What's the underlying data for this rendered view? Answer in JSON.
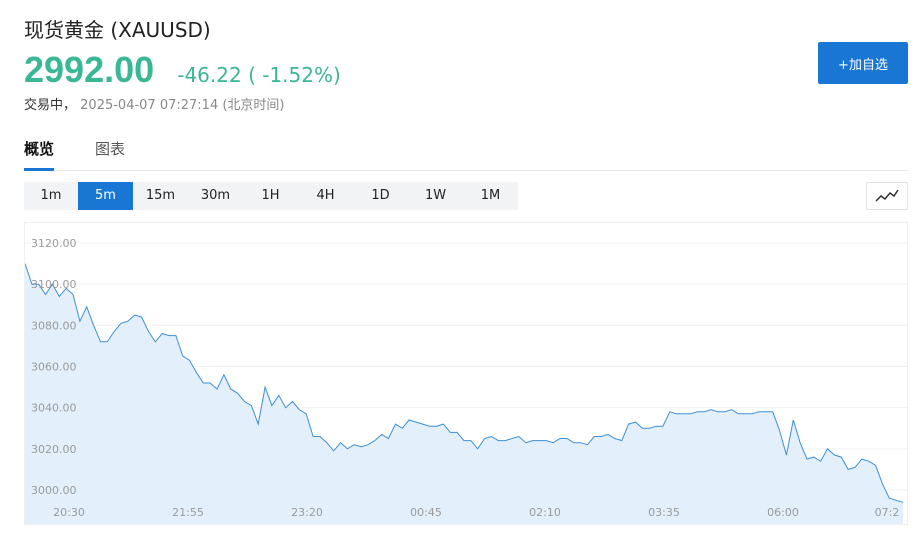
{
  "header": {
    "title": "现货黄金  (XAUUSD)",
    "price": "2992.00",
    "change": "-46.22 ( -1.52%)",
    "status": "交易中，",
    "timestamp": "2025-04-07 07:27:14 (北京时间)",
    "watch_button": "+加自选"
  },
  "tabs": [
    {
      "label": "概览",
      "active": true
    },
    {
      "label": "图表",
      "active": false
    }
  ],
  "intervals": [
    {
      "label": "1m",
      "active": false
    },
    {
      "label": "5m",
      "active": true
    },
    {
      "label": "15m",
      "active": false
    },
    {
      "label": "30m",
      "active": false
    },
    {
      "label": "1H",
      "active": false
    },
    {
      "label": "4H",
      "active": false
    },
    {
      "label": "1D",
      "active": false
    },
    {
      "label": "1W",
      "active": false
    },
    {
      "label": "1M",
      "active": false
    }
  ],
  "chart_type_icon": "line-chart-icon",
  "colors": {
    "price_green": "#3ab795",
    "accent_blue": "#1976d2",
    "line": "#3d8fd6",
    "area_fill": "#e3f0fc"
  },
  "chart_data": {
    "type": "area",
    "title": "",
    "xlabel": "",
    "ylabel": "",
    "ylim": [
      2993,
      3133
    ],
    "y_ticks": [
      "3120.00",
      "3100.00",
      "3080.00",
      "3060.00",
      "3040.00",
      "3020.00",
      "3000.00"
    ],
    "x_ticks": [
      "20:30",
      "21:55",
      "23:20",
      "00:45",
      "02:10",
      "03:35",
      "06:00",
      "07:2"
    ],
    "grid": true,
    "legend": "none",
    "values": [
      3110,
      3100,
      3100,
      3095,
      3100,
      3094,
      3098,
      3095,
      3082,
      3089,
      3080,
      3072,
      3072,
      3077,
      3081,
      3082,
      3085,
      3084,
      3077,
      3072,
      3076,
      3075,
      3075,
      3065,
      3063,
      3057,
      3052,
      3052,
      3049,
      3056,
      3049,
      3047,
      3043,
      3041,
      3032,
      3050,
      3041,
      3046,
      3040,
      3043,
      3039,
      3037,
      3026,
      3026,
      3023,
      3019,
      3023,
      3020,
      3022,
      3021,
      3022,
      3024,
      3027,
      3025,
      3032,
      3030,
      3034,
      3033,
      3032,
      3031,
      3031,
      3032,
      3028,
      3028,
      3024,
      3024,
      3020,
      3025,
      3026,
      3024,
      3024,
      3025,
      3026,
      3023,
      3024,
      3024,
      3024,
      3023,
      3025,
      3025,
      3023,
      3023,
      3022,
      3026,
      3026,
      3027,
      3025,
      3024,
      3032,
      3033,
      3030,
      3030,
      3031,
      3031,
      3038,
      3037,
      3037,
      3037,
      3038,
      3038,
      3039,
      3038,
      3038,
      3039,
      3037,
      3037,
      3037,
      3038,
      3038,
      3038,
      3029,
      3017,
      3034,
      3023,
      3015,
      3016,
      3014,
      3020,
      3017,
      3016,
      3010,
      3011,
      3015,
      3014,
      3012,
      3003,
      2996,
      2995,
      2994
    ]
  }
}
